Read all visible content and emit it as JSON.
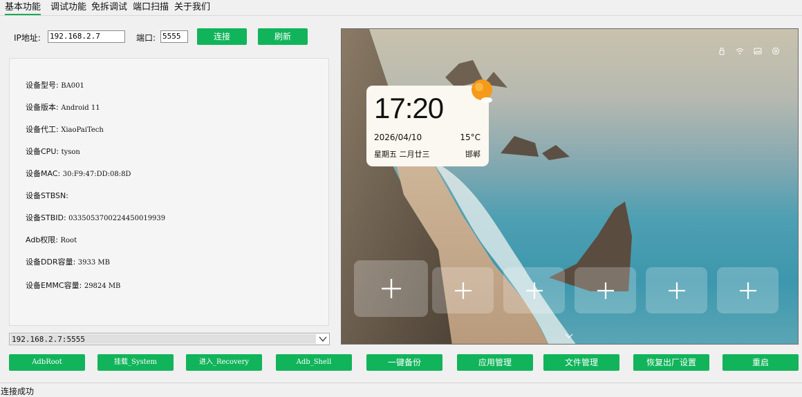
{
  "tabs": [
    "基本功能",
    "调试功能",
    "免拆调试",
    "端口扫描",
    "关于我们"
  ],
  "connection": {
    "ip_label": "IP地址:",
    "ip_value": "192.168.2.7",
    "port_label": "端口:",
    "port_value": "5555",
    "connect_label": "连接",
    "refresh_label": "刷新"
  },
  "device_info": [
    {
      "label": "设备型号:",
      "value": "BA001"
    },
    {
      "label": "设备版本:",
      "value": "Android 11"
    },
    {
      "label": "设备代工:",
      "value": "XiaoPaiTech"
    },
    {
      "label": "设备CPU:",
      "value": "tyson"
    },
    {
      "label": "设备MAC:",
      "value": "30:F9:47:DD:08:8D"
    },
    {
      "label": "设备STBSN:",
      "value": ""
    },
    {
      "label": "设备STBID:",
      "value": "0335053700224450019939"
    },
    {
      "label": "Adb权限: ",
      "value": "Root"
    },
    {
      "label": "设备DDR容量:",
      "value": "3933 MB"
    },
    {
      "label": "设备EMMC容量:",
      "value": "29824 MB"
    }
  ],
  "device_select": {
    "value": "192.168.2.7:5555"
  },
  "screen": {
    "time": "17:20",
    "date": "2026/04/10",
    "temperature": "15°C",
    "weekday": "星期五 二月廿三",
    "city": "邯郸",
    "status_icons": [
      "lock-icon",
      "wifi-icon",
      "image-icon",
      "at-icon"
    ],
    "tile_icons": [
      "plus-icon",
      "plus-icon",
      "plus-icon",
      "plus-icon",
      "plus-icon",
      "plus-icon"
    ]
  },
  "actions": [
    "AdbRoot",
    "挂载_System",
    "进入_Recovery",
    "Adb_Shell",
    "一键备份",
    "应用管理",
    "文件管理",
    "恢复出厂设置",
    "重启"
  ],
  "status_text": "连接成功",
  "colors": {
    "accent": "#11b45a"
  }
}
